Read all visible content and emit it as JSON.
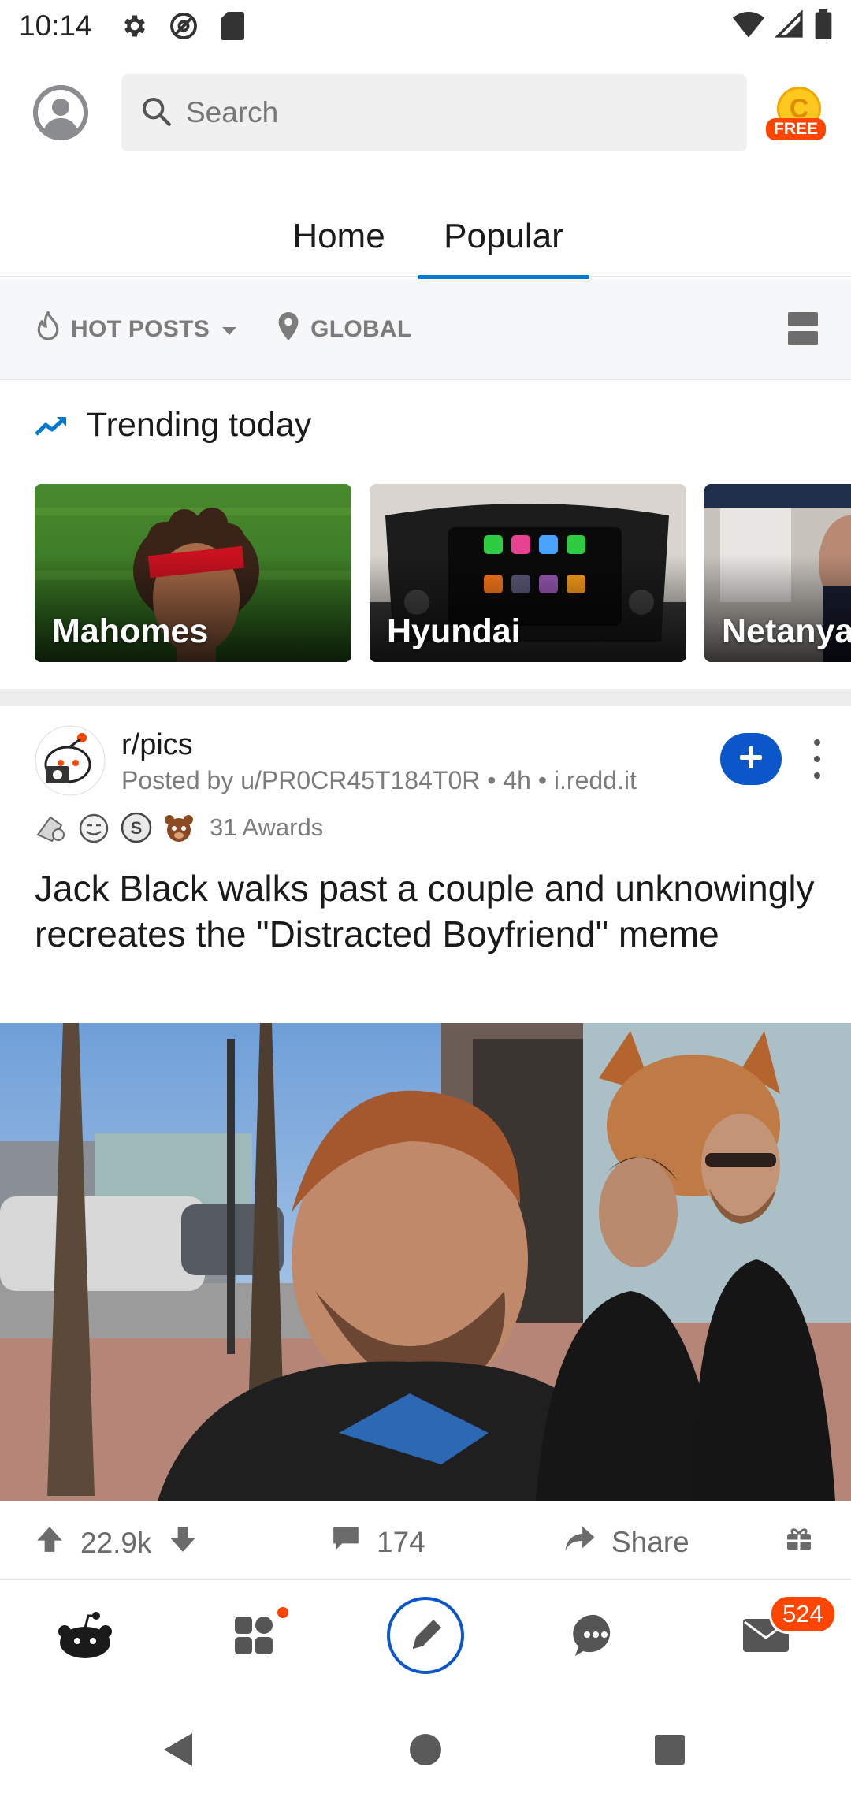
{
  "status_bar": {
    "time": "10:14",
    "left_icons": [
      "gear-icon",
      "at-sign-icon",
      "sd-card-icon"
    ],
    "right_icons": [
      "wifi-icon",
      "signal-icon",
      "battery-icon"
    ]
  },
  "top_bar": {
    "search_placeholder": "Search",
    "coin_letter": "C",
    "coin_badge": "FREE"
  },
  "tabs": [
    {
      "label": "Home",
      "active": false
    },
    {
      "label": "Popular",
      "active": true
    }
  ],
  "filters": {
    "sort_label": "HOT POSTS",
    "location_label": "GLOBAL"
  },
  "trending": {
    "title": "Trending today",
    "cards": [
      {
        "label": "Mahomes"
      },
      {
        "label": "Hyundai"
      },
      {
        "label": "Netanya"
      }
    ]
  },
  "post": {
    "subreddit": "r/pics",
    "meta": "Posted by u/PR0CR45T184T0R • 4h • i.redd.it",
    "awards_count": "31 Awards",
    "title": "Jack Black walks past a couple and unknowingly recreates the \"Distracted Boyfriend\" meme",
    "upvotes": "22.9k",
    "comments": "174",
    "share_label": "Share"
  },
  "bottom_nav": {
    "items": [
      "home-icon",
      "communities-icon",
      "create-post-icon",
      "chat-icon",
      "inbox-icon"
    ],
    "inbox_badge": "524"
  },
  "colors": {
    "accent": "#0079d3",
    "reddit_orange": "#ff4500",
    "join_blue": "#0b57c9"
  }
}
